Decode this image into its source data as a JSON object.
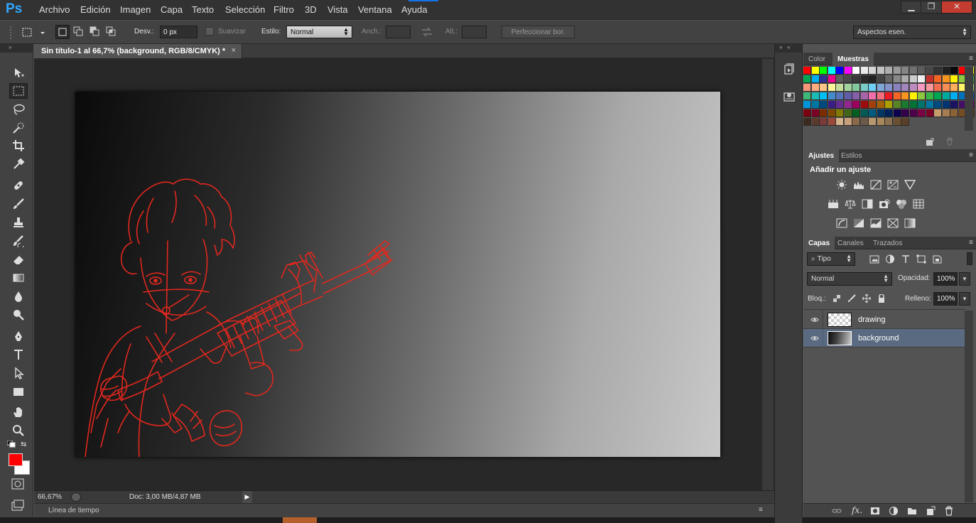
{
  "app": {
    "logo": "Ps"
  },
  "menu": [
    "Archivo",
    "Edición",
    "Imagen",
    "Capa",
    "Texto",
    "Selección",
    "Filtro",
    "3D",
    "Vista",
    "Ventana",
    "Ayuda"
  ],
  "window_controls": {
    "minimize": "▁",
    "restore": "❐",
    "close": "✕"
  },
  "options_bar": {
    "feather_label": "Desv.:",
    "feather_value": "0 px",
    "antialias_label": "Suavizar",
    "style_label": "Estilo:",
    "style_value": "Normal",
    "width_label": "Anch.:",
    "height_label": "Alt.:",
    "refine_button": "Perfeccionar bor.",
    "workspace_value": "Aspectos esen."
  },
  "document": {
    "tab_title": "Sin título-1 al 66,7% (background, RGB/8/CMYK) *",
    "close": "×",
    "zoom": "66,67%",
    "doc_info": "Doc: 3,00 MB/4,87 MB"
  },
  "timeline": {
    "label": "Línea de tiempo"
  },
  "tools": [
    "move-tool",
    "marquee-tool",
    "lasso-tool",
    "quick-select-tool",
    "crop-tool",
    "eyedropper-tool",
    "healing-brush-tool",
    "brush-tool",
    "clone-stamp-tool",
    "history-brush-tool",
    "eraser-tool",
    "gradient-tool",
    "blur-tool",
    "dodge-tool",
    "pen-tool",
    "type-tool",
    "path-select-tool",
    "rectangle-tool",
    "hand-tool",
    "zoom-tool"
  ],
  "colors": {
    "foreground": "#ff0000",
    "background": "#ffffff",
    "selection": "#5a6a80",
    "ps_blue": "#31a8ff"
  },
  "color_panel": {
    "tabs": [
      "Color",
      "Muestras"
    ],
    "active": "Muestras"
  },
  "adjustments_panel": {
    "tabs": [
      "Ajustes",
      "Estilos"
    ],
    "active": "Ajustes",
    "title": "Añadir un ajuste",
    "rows": [
      [
        "brightness-contrast-icon",
        "levels-icon",
        "curves-icon",
        "exposure-icon",
        "vibrance-icon"
      ],
      [
        "hue-saturation-icon",
        "color-balance-icon",
        "black-white-icon",
        "photo-filter-icon",
        "channel-mixer-icon",
        "color-lookup-icon"
      ],
      [
        "invert-icon",
        "posterize-icon",
        "threshold-icon",
        "selective-color-icon",
        "gradient-map-icon"
      ]
    ]
  },
  "layers_panel": {
    "tabs": [
      "Capas",
      "Canales",
      "Trazados"
    ],
    "active": "Capas",
    "filter_label": "Tipo",
    "blend_mode": "Normal",
    "opacity_label": "Opacidad:",
    "opacity_value": "100%",
    "lock_label": "Bloq.:",
    "fill_label": "Relleno:",
    "fill_value": "100%",
    "layers": [
      {
        "name": "drawing",
        "selected": false
      },
      {
        "name": "background",
        "selected": true
      }
    ]
  }
}
